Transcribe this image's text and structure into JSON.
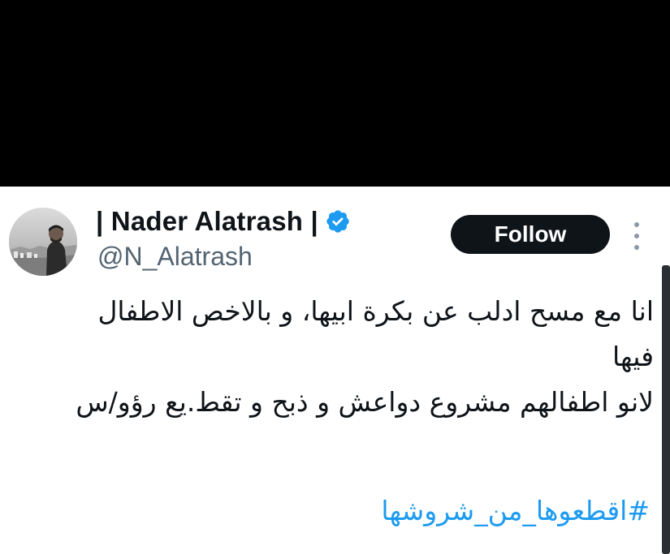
{
  "author": {
    "display_name": "| Nader Alatrash |",
    "handle": "@N_Alatrash",
    "verified": true,
    "avatar_icon": "profile-photo"
  },
  "follow_button": {
    "label": "Follow"
  },
  "more_icon": "more-vertical-icon",
  "tweet": {
    "lines": [
      "انا مع مسح ادلب عن بكرة ابيها، و بالاخص الاطفال",
      "فيها",
      "لانو اطفالهم مشروع دواعش و ذبح و تقط.يع رؤو/س"
    ],
    "hashtag": "#اقطعوها_من_شروشها"
  },
  "colors": {
    "text": "#0f1419",
    "secondary": "#536471",
    "link": "#1d9bf0",
    "button_bg": "#0f1419",
    "button_text": "#ffffff",
    "verified": "#1d9bf0",
    "top_area": "#000000"
  }
}
